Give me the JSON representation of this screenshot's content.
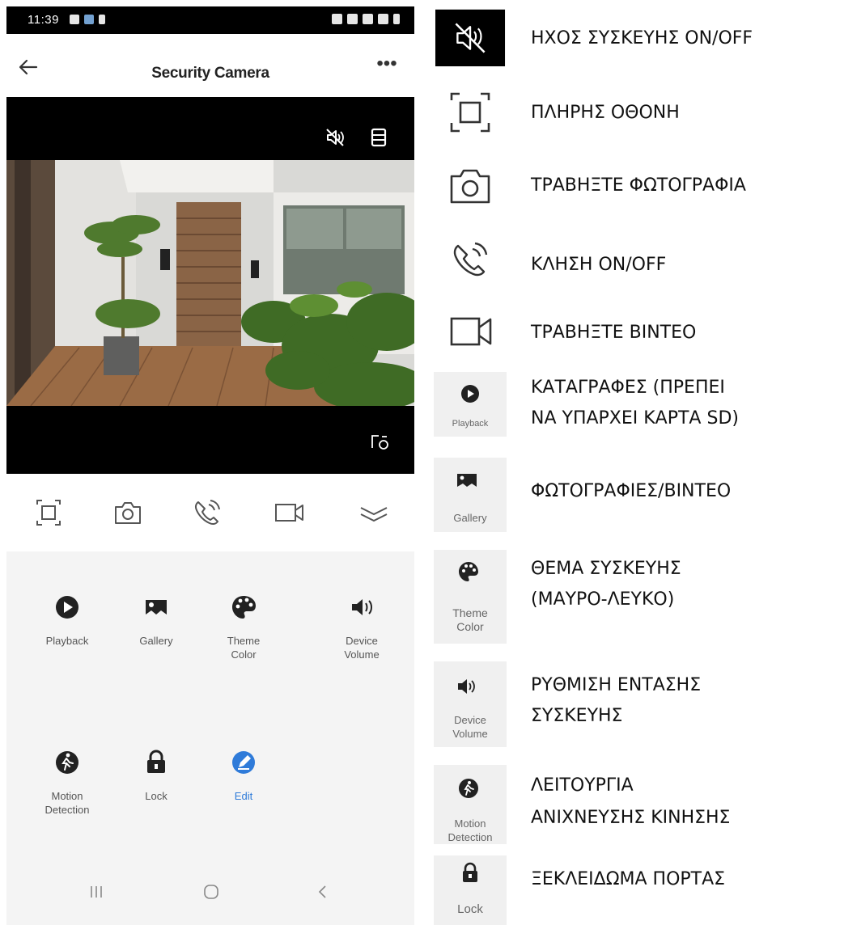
{
  "status_bar": {
    "time": "11:39"
  },
  "header": {
    "title": "Security Camera",
    "more": "•••"
  },
  "panel": {
    "tiles": [
      {
        "label": "Playback"
      },
      {
        "label": "Gallery"
      },
      {
        "label": "Theme\nColor"
      },
      {
        "label": "Device\nVolume"
      },
      {
        "label": "Motion\nDetection"
      },
      {
        "label": "Lock"
      },
      {
        "label": "Edit"
      }
    ]
  },
  "legend": [
    {
      "icon": "mute-speaker-icon",
      "text": "ΗΧΟΣ ΣΥΣΚΕΥΗΣ ON/OFF"
    },
    {
      "icon": "fullscreen-icon",
      "text": "ΠΛΗΡΗΣ ΟΘΟΝΗ"
    },
    {
      "icon": "camera-icon",
      "text": "ΤΡΑΒΗΞΤΕ ΦΩΤΟΓΡΑΦΙΑ"
    },
    {
      "icon": "phone-call-icon",
      "text": "ΚΛΗΣΗ ON/OFF"
    },
    {
      "icon": "video-camera-icon",
      "text": "ΤΡΑΒΗΞΤΕ ΒΙΝΤΕΟ"
    },
    {
      "icon": "playback-icon",
      "thumb_label": "Playback",
      "text_1": "ΚΑΤΑΓΡΑΦΕΣ (ΠΡΕΠΕΙ",
      "text_2": "ΝΑ ΥΠΑΡΧΕΙ ΚΑΡΤΑ SD)"
    },
    {
      "icon": "gallery-icon",
      "thumb_label": "Gallery",
      "text": "ΦΩΤΟΓΡΑΦΙΕΣ/ΒΙΝΤΕΟ"
    },
    {
      "icon": "palette-icon",
      "thumb_label": "Theme\nColor",
      "text_1": "ΘΕΜΑ ΣΥΣΚΕΥΗΣ",
      "text_2": "(ΜΑΥΡΟ-ΛΕΥΚΟ)"
    },
    {
      "icon": "volume-icon",
      "thumb_label": "Device\nVolume",
      "text_1": "ΡΥΘΜΙΣΗ ΕΝΤΑΣΗΣ",
      "text_2": "ΣΥΣΚΕΥΗΣ"
    },
    {
      "icon": "motion-detection-icon",
      "thumb_label": "Motion\nDetection",
      "text_1": "ΛΕΙΤΟΥΡΓΙΑ",
      "text_2": "ΑΝΙΧΝΕΥΣΗΣ ΚΙΝΗΣΗΣ"
    },
    {
      "icon": "lock-icon",
      "thumb_label": "Lock",
      "text": "ΞΕΚΛΕΙΔΩΜΑ ΠΟΡΤΑΣ"
    }
  ],
  "colors": {
    "accent": "#2f7bd9",
    "panel_bg": "#f4f4f4",
    "video_bg": "#000000"
  }
}
